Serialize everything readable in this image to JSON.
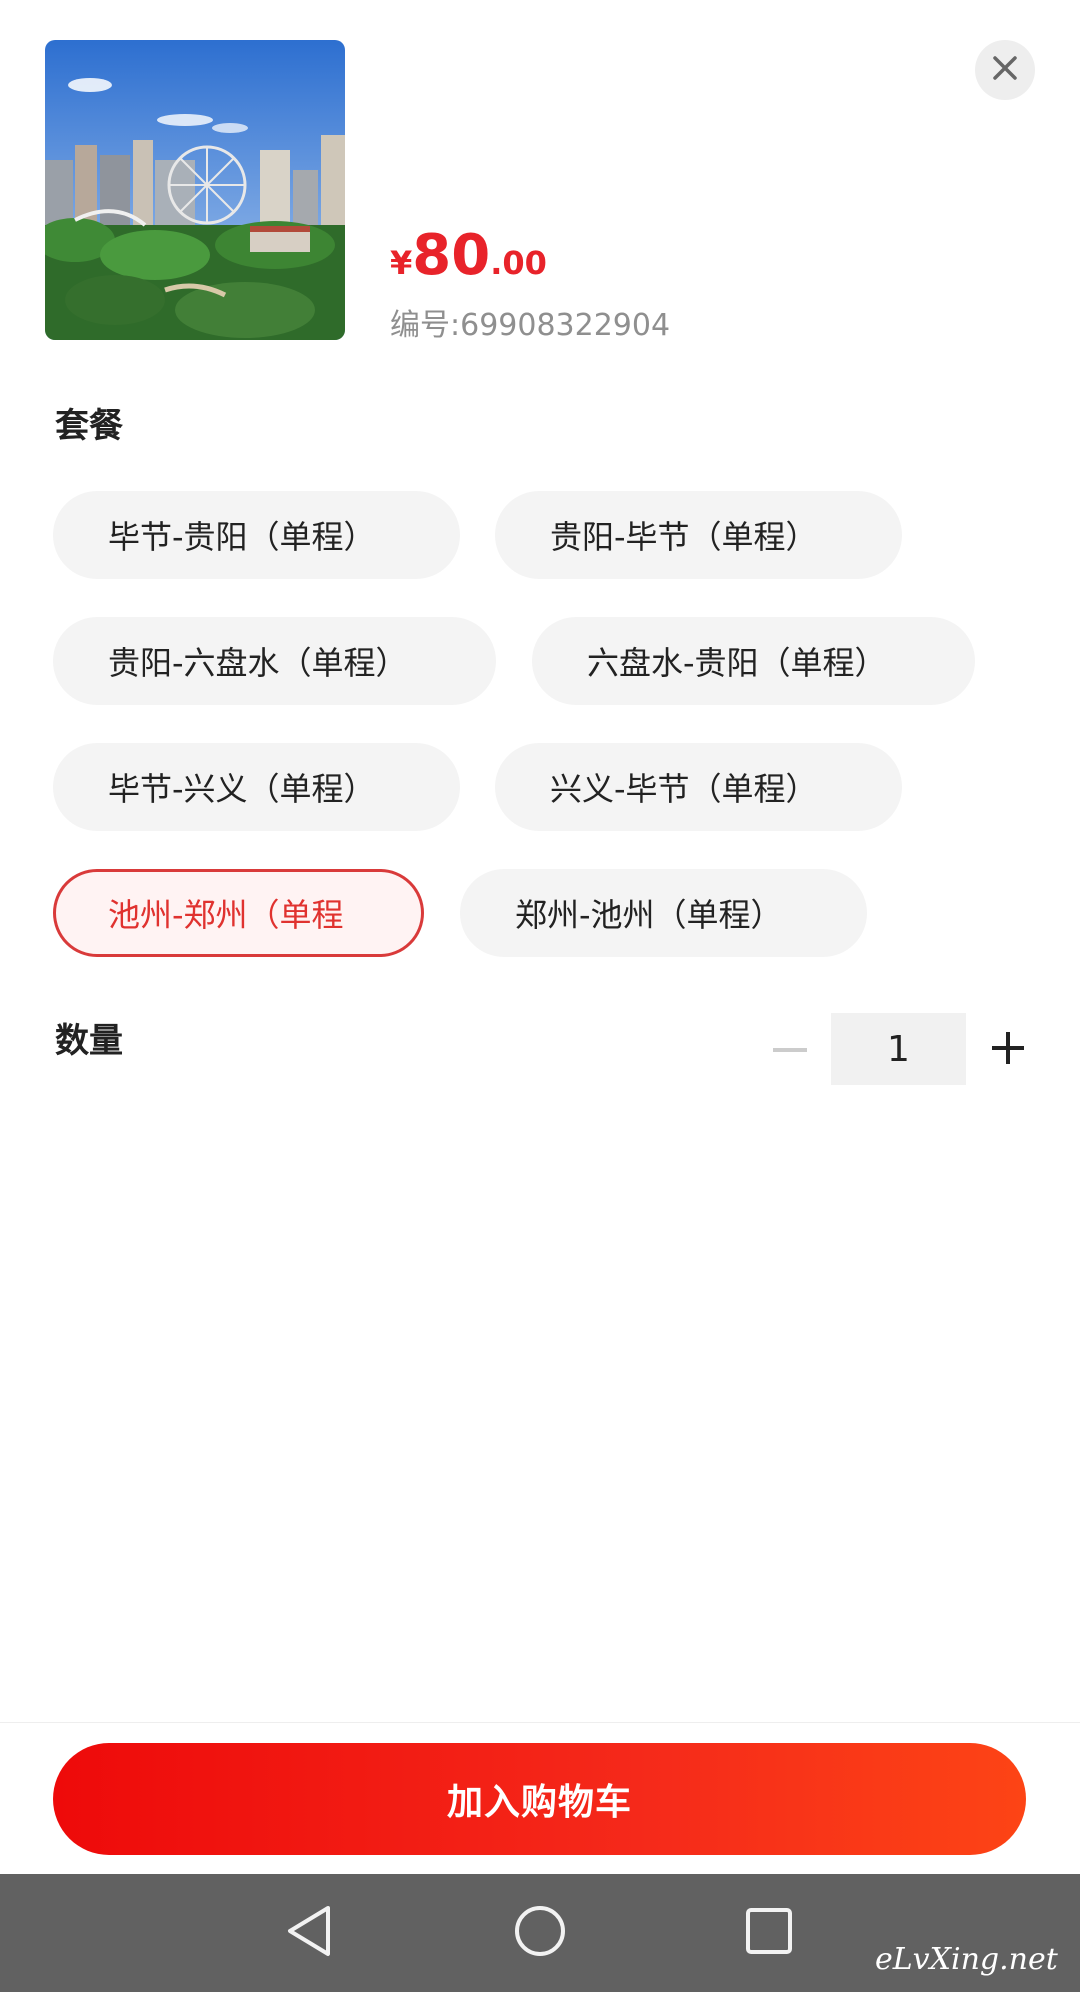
{
  "product": {
    "image_alt": "amusement park",
    "price_symbol": "¥",
    "price_integer": "80",
    "price_decimal": ".00",
    "code_label": "编号",
    "code_separator": ":",
    "code_value": "69908322904"
  },
  "package": {
    "title": "套餐",
    "options": [
      {
        "label": "毕节-贵阳（单程）",
        "selected": false
      },
      {
        "label": "贵阳-毕节（单程）",
        "selected": false
      },
      {
        "label": "贵阳-六盘水（单程）",
        "selected": false
      },
      {
        "label": "六盘水-贵阳（单程）",
        "selected": false
      },
      {
        "label": "毕节-兴义（单程）",
        "selected": false
      },
      {
        "label": "兴义-毕节（单程）",
        "selected": false
      },
      {
        "label": "池州-郑州（单程",
        "selected": true
      },
      {
        "label": "郑州-池州（单程）",
        "selected": false
      }
    ]
  },
  "quantity": {
    "title": "数量",
    "value": "1"
  },
  "footer": {
    "add_to_cart_label": "加入购物车"
  },
  "navbar": {
    "back_icon": "back-triangle-icon",
    "home_icon": "home-circle-icon",
    "recent_icon": "recent-square-icon"
  },
  "watermark": {
    "text": "eLvXing.net"
  },
  "colors": {
    "accent": "#e8232a",
    "chip_bg": "#f4f4f4",
    "selected_border": "#d93a3a",
    "navbar_bg": "#616161"
  }
}
